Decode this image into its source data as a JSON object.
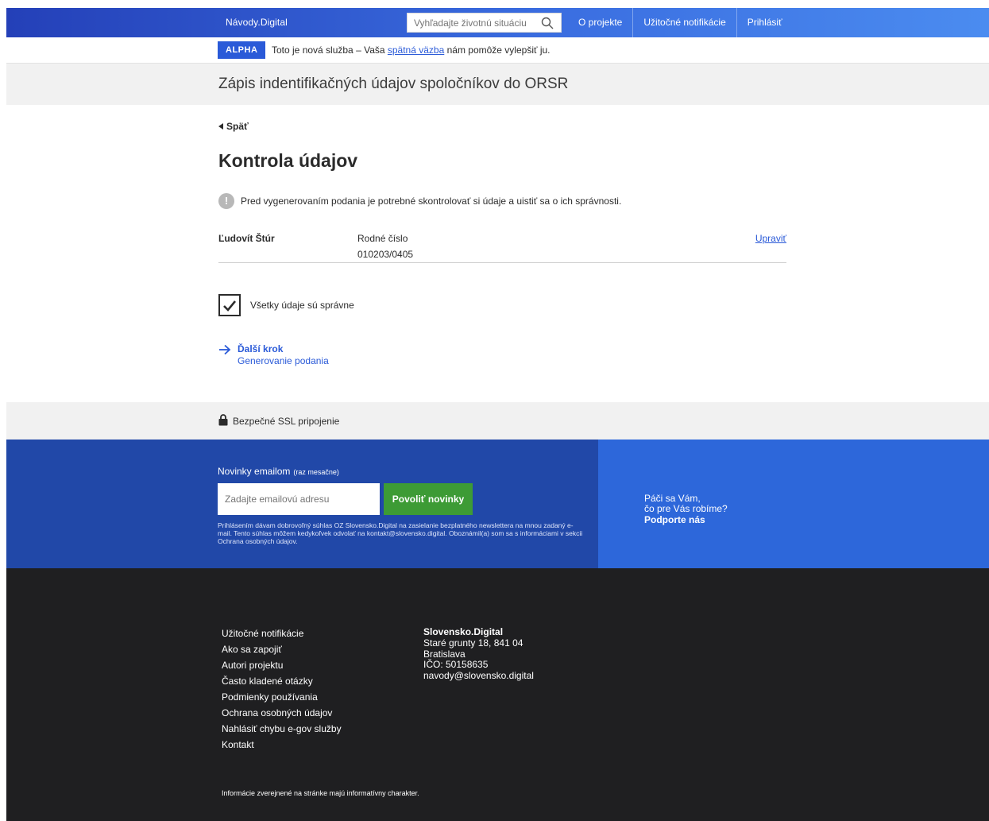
{
  "nav": {
    "brand": "Návody.Digital",
    "search_placeholder": "Vyhľadajte životnú situáciu",
    "links": [
      "O projekte",
      "Užitočné notifikácie",
      "Prihlásiť"
    ]
  },
  "alpha": {
    "badge": "ALPHA",
    "text_before": "Toto je nová služba – Vaša ",
    "link": "spätná väzba",
    "text_after": " nám pomôže vylepšiť ju."
  },
  "page": {
    "service_title": "Zápis indentifikačných údajov spoločníkov do ORSR",
    "back_label": "Späť",
    "heading": "Kontrola údajov",
    "notice_icon": "!",
    "notice": "Pred vygenerovaním podania je potrebné skontrolovať si údaje a uistiť sa o ich správnosti.",
    "person": {
      "name": "Ľudovít Štúr",
      "field_label": "Rodné číslo",
      "field_value": "010203/0405",
      "edit_label": "Upraviť"
    },
    "checkbox_label": "Všetky údaje sú správne",
    "checkbox_checked": true,
    "next_step_title": "Ďalší krok",
    "next_step_subtitle": "Generovanie podania"
  },
  "ssl": {
    "text": "Bezpečné SSL pripojenie"
  },
  "newsletter": {
    "heading": "Novinky emailom",
    "heading_note": "(raz mesačne)",
    "email_placeholder": "Zadajte emailovú adresu",
    "button": "Povoliť novinky",
    "legal": "Prihlásením dávam dobrovoľný súhlas OZ Slovensko.Digital na zasielanie bezplatného newslettera na mnou zadaný e-mail. Tento súhlas môžem kedykoľvek odvolať na kontakt@slovensko.digital. Oboznámil(a) som sa s informáciami v sekcii Ochrana osobných údajov."
  },
  "support": {
    "line1": "Páči sa Vám,",
    "line2": "čo pre Vás robíme?",
    "line3": "Podporte nás"
  },
  "footer": {
    "links": [
      "Užitočné notifikácie",
      "Ako sa zapojiť",
      "Autori projektu",
      "Často kladené otázky",
      "Podmienky používania",
      "Ochrana osobných údajov",
      "Nahlásiť chybu e-gov služby",
      "Kontakt"
    ],
    "org": {
      "name": "Slovensko.Digital",
      "street": "Staré grunty 18, 841 04",
      "city": "Bratislava",
      "ico": "IČO: 50158635",
      "email": "navody@slovensko.digital"
    },
    "note": "Informácie zverejnené na stránke majú informatívny charakter."
  },
  "colors": {
    "accent": "#2a5ad8",
    "newsletter_bg": "#2148a8",
    "support_bg": "#2d67da",
    "button_green": "#3d9b35",
    "footer_bg": "#1f1f21"
  }
}
